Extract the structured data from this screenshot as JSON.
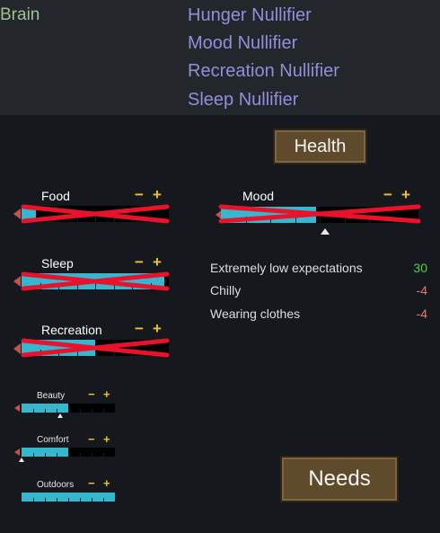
{
  "health_part": {
    "label": "Brain"
  },
  "hediffs": [
    "Hunger Nullifier",
    "Mood Nullifier",
    "Recreation Nullifier",
    "Sleep Nullifier"
  ],
  "buttons": {
    "health": "Health",
    "needs": "Needs"
  },
  "controls": {
    "minus": "−",
    "plus": "+"
  },
  "needs": {
    "food": {
      "label": "Food",
      "level": 0.1,
      "crossed": true
    },
    "sleep": {
      "label": "Sleep",
      "level": 0.97,
      "crossed": true
    },
    "recreation": {
      "label": "Recreation",
      "level": 0.5,
      "crossed": true
    },
    "mood": {
      "label": "Mood",
      "level": 0.48,
      "crossed": true
    },
    "beauty": {
      "label": "Beauty",
      "level": 0.5
    },
    "comfort": {
      "label": "Comfort",
      "level": 0.5
    },
    "outdoors": {
      "label": "Outdoors",
      "level": 1.0
    }
  },
  "thoughts": [
    {
      "label": "Extremely low expectations",
      "value": "30",
      "kind": "pos"
    },
    {
      "label": "Chilly",
      "value": "-4",
      "kind": "neg"
    },
    {
      "label": "Wearing clothes",
      "value": "-4",
      "kind": "neg"
    }
  ],
  "colors": {
    "bar_fill": "#35b8cf",
    "cross": "#e8132b",
    "plus_minus": "#f2c12e",
    "positive": "#55d04d",
    "negative": "#e87a70",
    "hediff": "#8f8fdc",
    "part": "#9fc293"
  }
}
